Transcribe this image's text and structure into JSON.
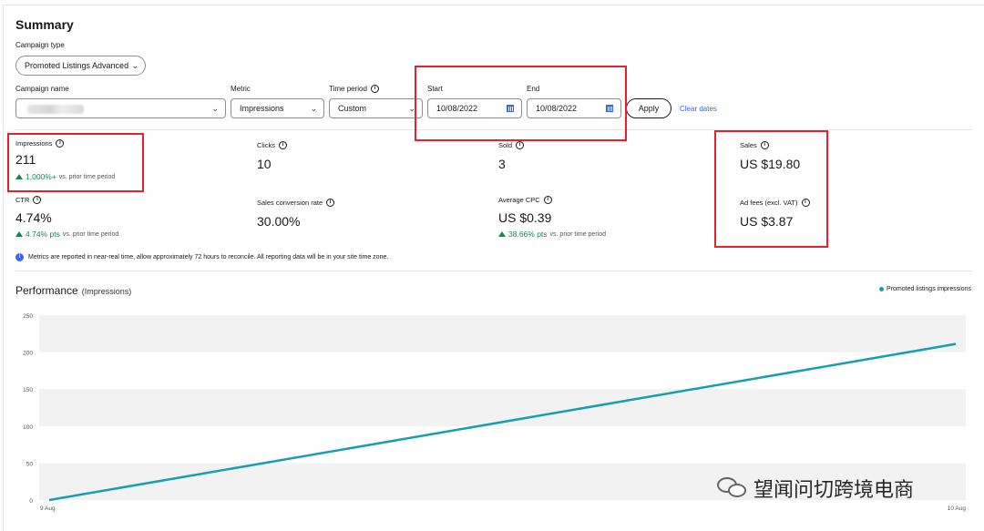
{
  "summary": {
    "title": "Summary",
    "campaign_type_label": "Campaign type",
    "campaign_type_value": "Promoted Listings Advanced",
    "campaign_name_label": "Campaign name",
    "metric_label": "Metric",
    "metric_value": "Impressions",
    "time_period_label": "Time period",
    "time_period_value": "Custom",
    "start_label": "Start",
    "start_value": "10/08/2022",
    "end_label": "End",
    "end_value": "10/08/2022",
    "apply_label": "Apply",
    "clear_label": "Clear dates"
  },
  "metrics": {
    "impressions": {
      "label": "Impressions",
      "value": "211",
      "delta": "1,000%+",
      "delta_sub": "vs. prior time period"
    },
    "clicks": {
      "label": "Clicks",
      "value": "10"
    },
    "sold": {
      "label": "Sold",
      "value": "3"
    },
    "sales": {
      "label": "Sales",
      "value": "US $19.80"
    },
    "ctr": {
      "label": "CTR",
      "value": "4.74%",
      "delta": "4.74% pts",
      "delta_sub": "vs. prior time period"
    },
    "conversion": {
      "label": "Sales conversion rate",
      "value": "30.00%"
    },
    "cpc": {
      "label": "Average CPC",
      "value": "US $0.39",
      "delta": "38.66% pts",
      "delta_sub": "vs. prior time period"
    },
    "adfees": {
      "label": "Ad fees (excl. VAT)",
      "value": "US $3.87"
    }
  },
  "note": "Metrics are reported in near-real time, allow approximately 72 hours to reconcile. All reporting data will be in your site time zone.",
  "performance": {
    "title": "Performance",
    "subtitle": "(Impressions)",
    "legend": "Promoted listings impressions"
  },
  "chart_data": {
    "type": "line",
    "categories": [
      "9 Aug",
      "10 Aug"
    ],
    "series": [
      {
        "name": "Promoted listings impressions",
        "values": [
          0,
          211
        ],
        "color": "#15a0b0"
      }
    ],
    "yticks": [
      0,
      50,
      100,
      150,
      200,
      250
    ],
    "ylim": [
      0,
      250
    ],
    "grid": "alternating bands"
  },
  "watermark": "望闻问切跨境电商",
  "colors": {
    "accent": "#3665f3",
    "positive": "#14884d",
    "series": "#15a0b0",
    "highlight": "#e8202e"
  },
  "icons": [
    "chevron-down-icon",
    "calendar-icon",
    "info-icon",
    "up-triangle-icon",
    "wechat-icon"
  ]
}
